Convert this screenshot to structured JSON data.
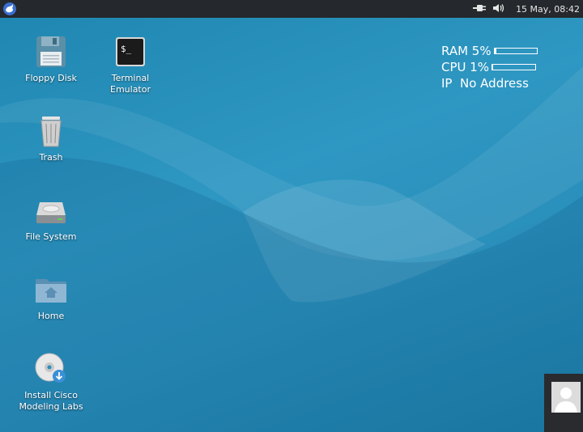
{
  "panel": {
    "menu_icon": "xfce-mouse-icon",
    "clock": "15 May, 08:42",
    "tray_icons": [
      "power-plug-icon",
      "volume-icon"
    ]
  },
  "desktop_icons": [
    {
      "label": "Floppy Disk",
      "icon": "floppy-disk-icon"
    },
    {
      "label": "Terminal\nEmulator",
      "icon": "terminal-icon"
    },
    {
      "label": "Trash",
      "icon": "trash-icon"
    },
    {
      "label": "File System",
      "icon": "hard-drive-icon"
    },
    {
      "label": "Home",
      "icon": "home-folder-icon"
    },
    {
      "label": "Install Cisco\nModeling Labs",
      "icon": "cd-install-icon"
    }
  ],
  "sysmon": {
    "ram_label": "RAM 5%",
    "ram_level": 0.05,
    "cpu_label": "CPU 1%",
    "cpu_level": 0.01,
    "ip_label": "IP  No Address"
  },
  "user_tile": {
    "icon": "user-avatar-icon"
  },
  "colors": {
    "panel_bg": "#25282c",
    "desktop_bg": "#2a8db7"
  }
}
